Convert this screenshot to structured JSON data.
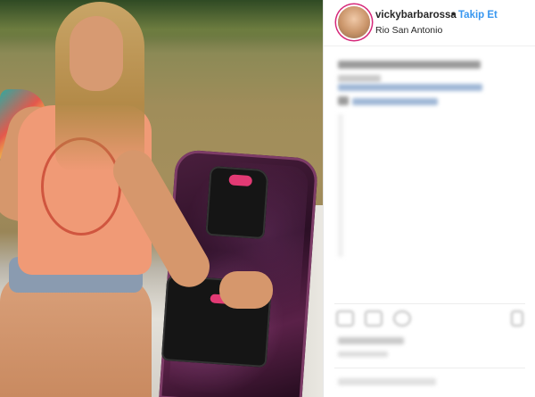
{
  "post": {
    "username": "vickybarbarossa",
    "separator": "•",
    "follow_label": "Takip Et",
    "location": "Rio San Antonio"
  },
  "colors": {
    "link": "#3897f0",
    "text": "#262626",
    "story_ring": "#d6287a"
  },
  "icons": [
    "like-icon",
    "comment-icon",
    "share-icon",
    "bookmark-icon"
  ]
}
